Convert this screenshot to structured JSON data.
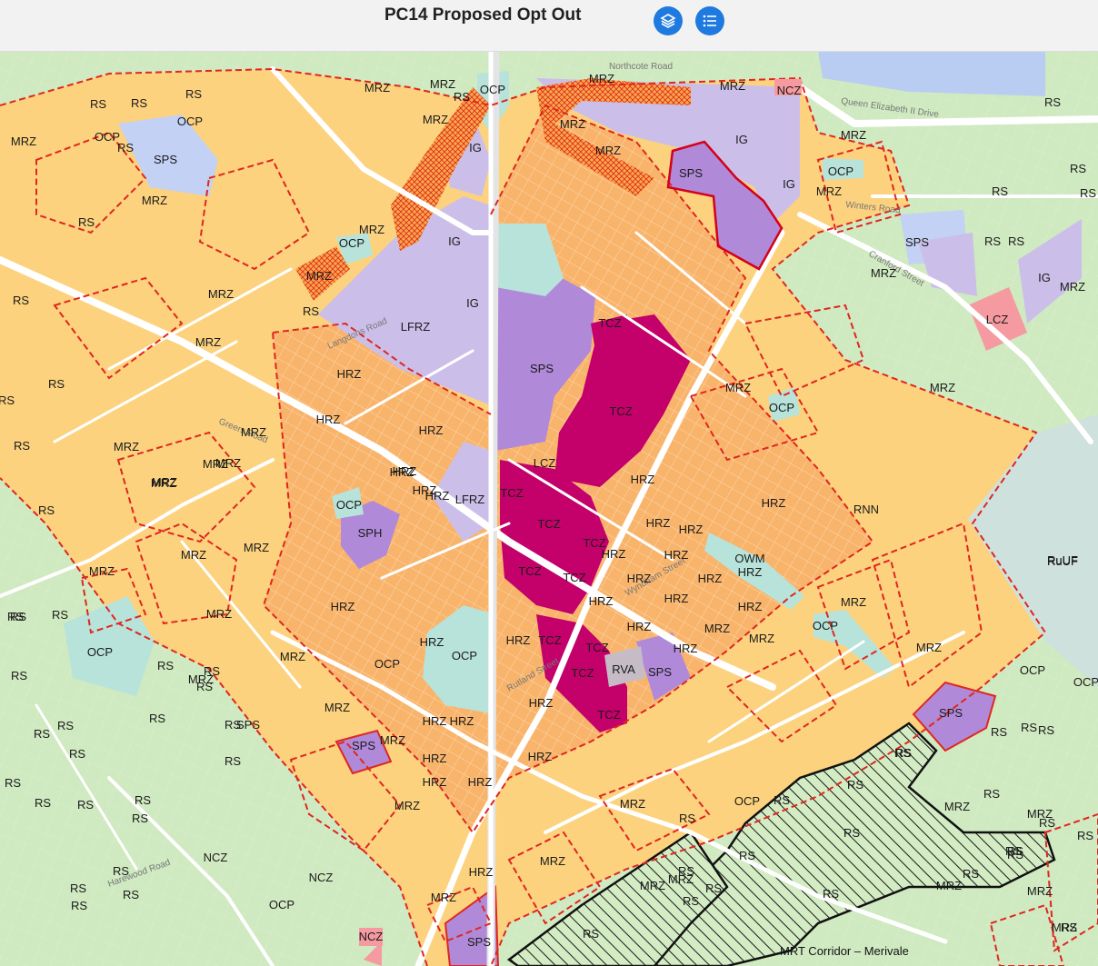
{
  "header": {
    "title": "PC14 Proposed Opt Out",
    "layers_button": "layers-icon",
    "legend_button": "legend-list-icon"
  },
  "colors": {
    "rs": "#cfe9c0",
    "mrz": "#fcd27e",
    "hrz": "#f9b46b",
    "ig": "#cbbfe9",
    "sps": "#b08ad8",
    "tcz": "#c4006b",
    "ocp": "#b7e3da",
    "lcz": "#f59aa0",
    "ruuf": "#cfe1dc",
    "water": "#b9cdf2",
    "boundary": "#e0261f"
  },
  "map": {
    "road_labels": [
      "Queen Elizabeth II Drive",
      "Northcote Road",
      "Winters Road",
      "Cranford Street",
      "Langdons Road",
      "Greers Road",
      "Wyndham Street",
      "Rutland Street",
      "Harewood Road"
    ],
    "corridor_label": "MRT Corridor – Merivale",
    "zone_labels": [
      {
        "t": "MRZ"
      },
      {
        "t": "MRZ"
      },
      {
        "t": "OCP"
      },
      {
        "t": "RS"
      },
      {
        "t": "MRZ"
      },
      {
        "t": "MRZ"
      },
      {
        "t": "NCZ"
      },
      {
        "t": "RS"
      },
      {
        "t": "RS"
      },
      {
        "t": "RS"
      },
      {
        "t": "RS"
      },
      {
        "t": "OCP"
      },
      {
        "t": "RS"
      },
      {
        "t": "MRZ"
      },
      {
        "t": "OCP"
      },
      {
        "t": "SPS"
      },
      {
        "t": "MRZ"
      },
      {
        "t": "IG"
      },
      {
        "t": "MRZ"
      },
      {
        "t": "MRZ"
      },
      {
        "t": "IG"
      },
      {
        "t": "IG"
      },
      {
        "t": "SPS"
      },
      {
        "t": "MRZ"
      },
      {
        "t": "OCP"
      },
      {
        "t": "RS"
      },
      {
        "t": "RS"
      },
      {
        "t": "MRZ"
      },
      {
        "t": "RS"
      },
      {
        "t": "RS"
      },
      {
        "t": "MRZ"
      },
      {
        "t": "MRZ"
      },
      {
        "t": "OCP"
      },
      {
        "t": "IG"
      },
      {
        "t": "SPS"
      },
      {
        "t": "RS"
      },
      {
        "t": "IG"
      },
      {
        "t": "RS"
      },
      {
        "t": "MRZ"
      },
      {
        "t": "MRZ"
      },
      {
        "t": "IG"
      },
      {
        "t": "RS"
      },
      {
        "t": "LCZ"
      },
      {
        "t": "MRZ"
      },
      {
        "t": "MRZ"
      },
      {
        "t": "RS"
      },
      {
        "t": "LFRZ"
      },
      {
        "t": "SPS"
      },
      {
        "t": "HRZ"
      },
      {
        "t": "HRZ"
      },
      {
        "t": "TCZ"
      },
      {
        "t": "TCZ"
      },
      {
        "t": "MRZ"
      },
      {
        "t": "HRZ"
      },
      {
        "t": "HRZ"
      },
      {
        "t": "RS"
      },
      {
        "t": "OCP"
      },
      {
        "t": "MRZ"
      },
      {
        "t": "MRZ"
      },
      {
        "t": "RuUF"
      },
      {
        "t": "MRZ"
      },
      {
        "t": "RS"
      },
      {
        "t": "RS"
      },
      {
        "t": "MRZ"
      },
      {
        "t": "MRZ"
      },
      {
        "t": "HRZ"
      },
      {
        "t": "HRZ"
      },
      {
        "t": "LFRZ"
      },
      {
        "t": "LCZ"
      },
      {
        "t": "TCZ"
      },
      {
        "t": "TCZ"
      },
      {
        "t": "HRZ"
      },
      {
        "t": "HRZ"
      },
      {
        "t": "MRZ"
      },
      {
        "t": "OCP"
      },
      {
        "t": "SPH"
      },
      {
        "t": "MRZ"
      },
      {
        "t": "MRZ"
      },
      {
        "t": "TCZ"
      },
      {
        "t": "HRZ"
      },
      {
        "t": "HRZ"
      },
      {
        "t": "HRZ"
      },
      {
        "t": "RNN"
      },
      {
        "t": "RS"
      },
      {
        "t": "MRZ"
      },
      {
        "t": "MRZ"
      },
      {
        "t": "MRZ"
      },
      {
        "t": "TCZ"
      },
      {
        "t": "TCZ"
      },
      {
        "t": "HRZ"
      },
      {
        "t": "HRZ"
      },
      {
        "t": "OWM"
      },
      {
        "t": "HRZ"
      },
      {
        "t": "RuUF"
      },
      {
        "t": "MRZ"
      },
      {
        "t": "RS"
      },
      {
        "t": "HRZ"
      },
      {
        "t": "HRZ"
      },
      {
        "t": "OCP"
      },
      {
        "t": "HRZ"
      },
      {
        "t": "HRZ"
      },
      {
        "t": "HRZ"
      },
      {
        "t": "HRZ"
      },
      {
        "t": "HRZ"
      },
      {
        "t": "MRZ"
      },
      {
        "t": "MRZ"
      },
      {
        "t": "RS"
      },
      {
        "t": "RS"
      },
      {
        "t": "MRZ"
      },
      {
        "t": "OCP"
      },
      {
        "t": "HRZ"
      },
      {
        "t": "HRZ"
      },
      {
        "t": "TCZ"
      },
      {
        "t": "TCZ"
      },
      {
        "t": "HRZ"
      },
      {
        "t": "MRZ"
      },
      {
        "t": "OCP"
      },
      {
        "t": "MRZ"
      },
      {
        "t": "OCP"
      },
      {
        "t": "OCP"
      },
      {
        "t": "RS"
      },
      {
        "t": "RS"
      },
      {
        "t": "RS"
      },
      {
        "t": "OCP"
      },
      {
        "t": "HRZ"
      },
      {
        "t": "HRZ"
      },
      {
        "t": "TCZ"
      },
      {
        "t": "RVA"
      },
      {
        "t": "SPS"
      },
      {
        "t": "HRZ"
      },
      {
        "t": "MRZ"
      },
      {
        "t": "MRZ"
      },
      {
        "t": "RS"
      },
      {
        "t": "RS"
      },
      {
        "t": "RS"
      },
      {
        "t": "RS"
      },
      {
        "t": "RS"
      },
      {
        "t": "HRZ"
      },
      {
        "t": "TCZ"
      },
      {
        "t": "MRZ"
      },
      {
        "t": "SPS"
      },
      {
        "t": "RS"
      },
      {
        "t": "RS"
      },
      {
        "t": "RS"
      },
      {
        "t": "RS"
      },
      {
        "t": "SPS"
      },
      {
        "t": "RS"
      },
      {
        "t": "RS"
      },
      {
        "t": "SPS"
      },
      {
        "t": "MRZ"
      },
      {
        "t": "HRZ"
      },
      {
        "t": "RS"
      },
      {
        "t": "MRZ"
      },
      {
        "t": "RS"
      },
      {
        "t": "RS"
      },
      {
        "t": "HRZ"
      },
      {
        "t": "HRZ"
      },
      {
        "t": "MRZ"
      },
      {
        "t": "RS"
      },
      {
        "t": "RS"
      },
      {
        "t": "RS"
      },
      {
        "t": "RS"
      },
      {
        "t": "RS"
      },
      {
        "t": "HRZ"
      },
      {
        "t": "MRZ"
      },
      {
        "t": "MRZ"
      },
      {
        "t": "OCP"
      },
      {
        "t": "RS"
      },
      {
        "t": "RS"
      },
      {
        "t": "RS"
      },
      {
        "t": "RS"
      },
      {
        "t": "RS"
      },
      {
        "t": "RS"
      },
      {
        "t": "RS"
      },
      {
        "t": "RS"
      },
      {
        "t": "RS"
      },
      {
        "t": "MRZ"
      },
      {
        "t": "RS"
      },
      {
        "t": "RS"
      },
      {
        "t": "RS"
      },
      {
        "t": "NCZ"
      },
      {
        "t": "NCZ"
      },
      {
        "t": "RS"
      },
      {
        "t": "RS"
      },
      {
        "t": "OCP"
      },
      {
        "t": "RS"
      },
      {
        "t": "MRZ"
      },
      {
        "t": "MRZ"
      },
      {
        "t": "SPS"
      },
      {
        "t": "NCZ"
      },
      {
        "t": "RS"
      },
      {
        "t": "RS"
      },
      {
        "t": "MRZ"
      },
      {
        "t": "MRZ"
      },
      {
        "t": "MRZ"
      },
      {
        "t": "RS"
      },
      {
        "t": "RS"
      },
      {
        "t": "RS"
      }
    ]
  }
}
